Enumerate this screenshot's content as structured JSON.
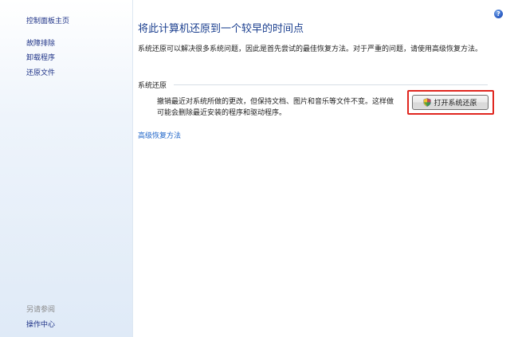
{
  "sidebar": {
    "home": "控制面板主页",
    "links": [
      "故障排除",
      "卸载程序",
      "还原文件"
    ],
    "see_also_heading": "另请参阅",
    "see_also_links": [
      "操作中心"
    ]
  },
  "main": {
    "help_symbol": "?",
    "title": "将此计算机还原到一个较早的时间点",
    "intro": "系统还原可以解决很多系统问题，因此是首先尝试的最佳恢复方法。对于严重的问题，请使用高级恢复方法。",
    "system_restore": {
      "group_label": "系统还原",
      "description": "撤销最近对系统所做的更改，但保持文档、图片和音乐等文件不变。这样做可能会删除最近安装的程序和驱动程序。",
      "button_label": "打开系统还原"
    },
    "advanced_link": "高级恢复方法"
  },
  "colors": {
    "link": "#1e3287",
    "title": "#1b3f8f",
    "highlight": "#e0261f"
  }
}
